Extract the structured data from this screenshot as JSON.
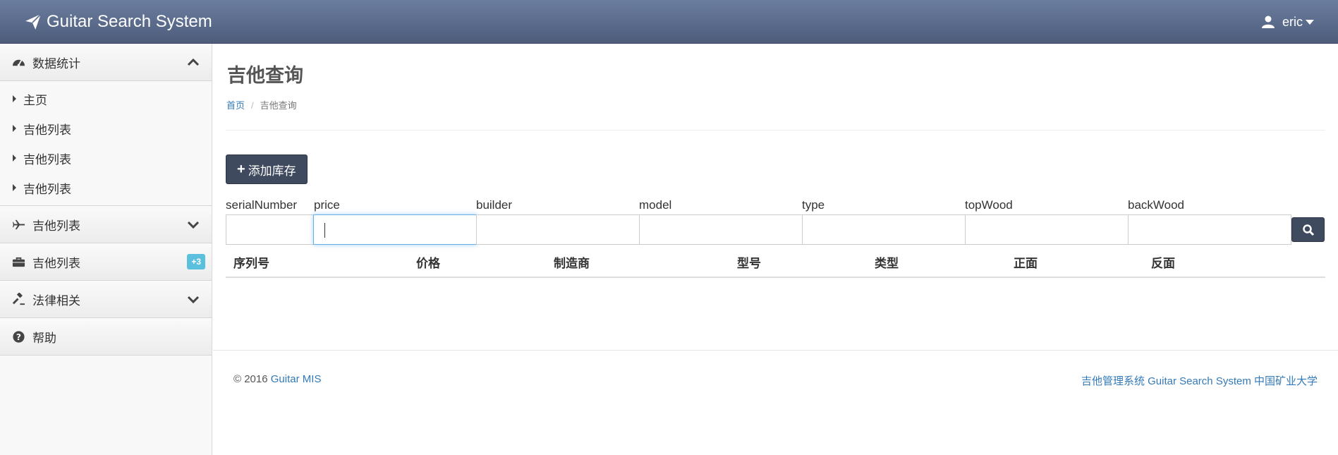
{
  "header": {
    "brand": "Guitar Search System",
    "user": "eric"
  },
  "sidebar": {
    "sections": [
      {
        "label": "数据统计",
        "icon": "dashboard-icon",
        "expanded": true,
        "items": [
          "主页",
          "吉他列表",
          "吉他列表",
          "吉他列表"
        ]
      },
      {
        "label": "吉他列表",
        "icon": "plane-icon",
        "expanded": false
      },
      {
        "label": "吉他列表",
        "icon": "briefcase-icon",
        "badge": "+3"
      },
      {
        "label": "法律相关",
        "icon": "gavel-icon",
        "expanded": false
      },
      {
        "label": "帮助",
        "icon": "question-circle-icon"
      }
    ]
  },
  "page": {
    "title": "吉他查询",
    "breadcrumb": {
      "home": "首页",
      "current": "吉他查询"
    },
    "add_button": "添加库存"
  },
  "filters": [
    {
      "label": "serialNumber",
      "value": ""
    },
    {
      "label": "price",
      "value": ""
    },
    {
      "label": "builder",
      "value": ""
    },
    {
      "label": "model",
      "value": ""
    },
    {
      "label": "type",
      "value": ""
    },
    {
      "label": "topWood",
      "value": ""
    },
    {
      "label": "backWood",
      "value": ""
    }
  ],
  "table": {
    "columns": [
      "序列号",
      "价格",
      "制造商",
      "型号",
      "类型",
      "正面",
      "反面"
    ],
    "rows": []
  },
  "footer": {
    "copyright": "© 2016",
    "link": "Guitar MIS",
    "right": "吉他管理系统 Guitar Search System 中国矿业大学"
  },
  "colors": {
    "header_start": "#6b7da0",
    "header_end": "#4d5c7a",
    "button": "#3f4a5f",
    "link": "#337ab7",
    "badge": "#5bc0de"
  }
}
